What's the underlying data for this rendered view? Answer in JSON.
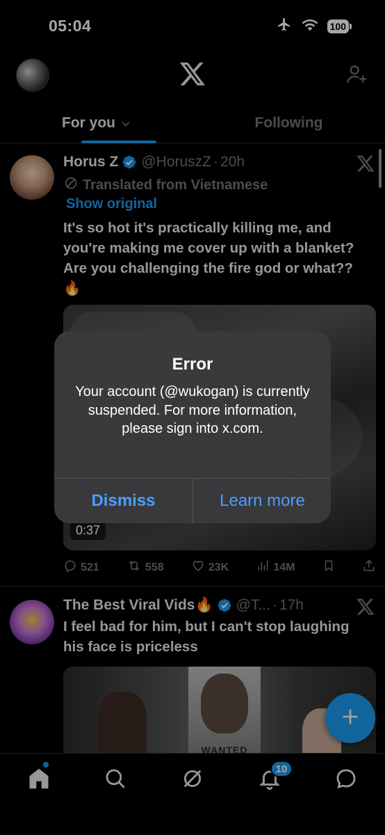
{
  "status_bar": {
    "time": "05:04",
    "battery": "100",
    "icons": [
      "airplane-icon",
      "wifi-icon",
      "battery-icon"
    ]
  },
  "header": {
    "logo": "x-logo-icon",
    "add_user_icon": "add-user-icon"
  },
  "tabs": [
    {
      "label": "For you",
      "active": true
    },
    {
      "label": "Following",
      "active": false
    }
  ],
  "tweets": [
    {
      "name": "Horus Z",
      "handle": "@HoruszZ",
      "separator": "·",
      "time": "20h",
      "translated_label": "Translated from Vietnamese",
      "show_original": "Show original",
      "text": "It's so hot it's practically killing me, and you're making me cover up with a blanket? Are you challenging the fire god or what?? 🔥",
      "video_duration": "0:37",
      "stats": {
        "replies": "521",
        "reposts": "558",
        "likes": "23K",
        "views": "14M"
      }
    },
    {
      "name": "The Best Viral Vids🔥",
      "handle": "@T...",
      "separator": "·",
      "time": "17h",
      "text": "I feel bad for him, but I can't stop laughing his face is priceless",
      "media_caption": "WANTED"
    }
  ],
  "alert": {
    "title": "Error",
    "message": "Your account (@wukogan) is currently suspended. For more information, please sign into x.com.",
    "dismiss_label": "Dismiss",
    "learn_more_label": "Learn more"
  },
  "fab": {
    "icon": "plus-icon"
  },
  "bottom_nav": {
    "items": [
      "home-icon",
      "search-icon",
      "grok-icon",
      "notifications-icon",
      "messages-icon"
    ],
    "notification_count": "10"
  },
  "colors": {
    "accent": "#1d9bf0",
    "background": "#000000",
    "secondary_text": "#71767b",
    "alert_button": "#4a9eff"
  }
}
